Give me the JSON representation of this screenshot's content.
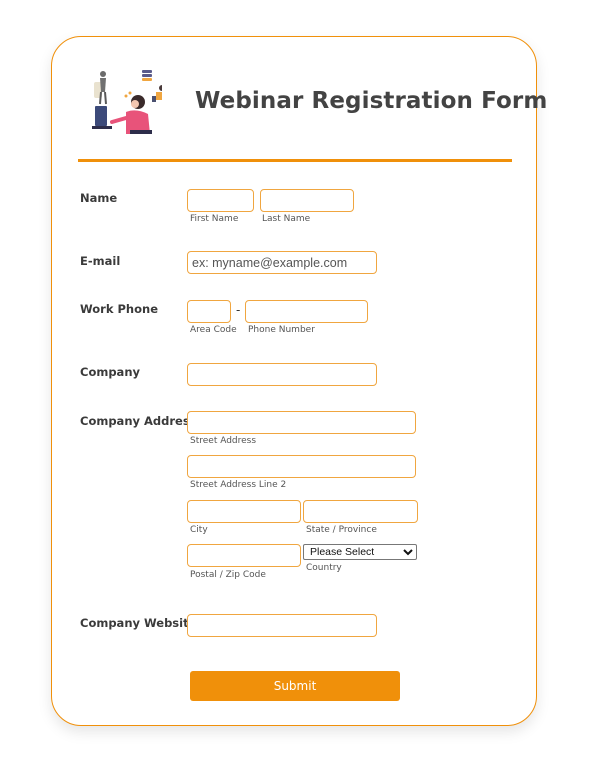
{
  "form": {
    "title": "Webinar Registration Form",
    "accent_color": "#f0900a",
    "illustration_icon": "person-at-computer-illustration"
  },
  "fields": {
    "name": {
      "label": "Name",
      "first_sublabel": "First Name",
      "last_sublabel": "Last Name",
      "first_value": "",
      "last_value": ""
    },
    "email": {
      "label": "E-mail",
      "placeholder": "ex: myname@example.com",
      "value": ""
    },
    "phone": {
      "label": "Work Phone",
      "separator": "-",
      "area_sublabel": "Area Code",
      "number_sublabel": "Phone Number",
      "area_value": "",
      "number_value": ""
    },
    "company": {
      "label": "Company",
      "value": ""
    },
    "address": {
      "label": "Company Address",
      "street_sublabel": "Street Address",
      "street2_sublabel": "Street Address Line 2",
      "city_sublabel": "City",
      "state_sublabel": "State / Province",
      "postal_sublabel": "Postal / Zip Code",
      "country_sublabel": "Country",
      "country_selected": "Please Select"
    },
    "website": {
      "label": "Company Website",
      "value": ""
    }
  },
  "submit": {
    "label": "Submit"
  }
}
